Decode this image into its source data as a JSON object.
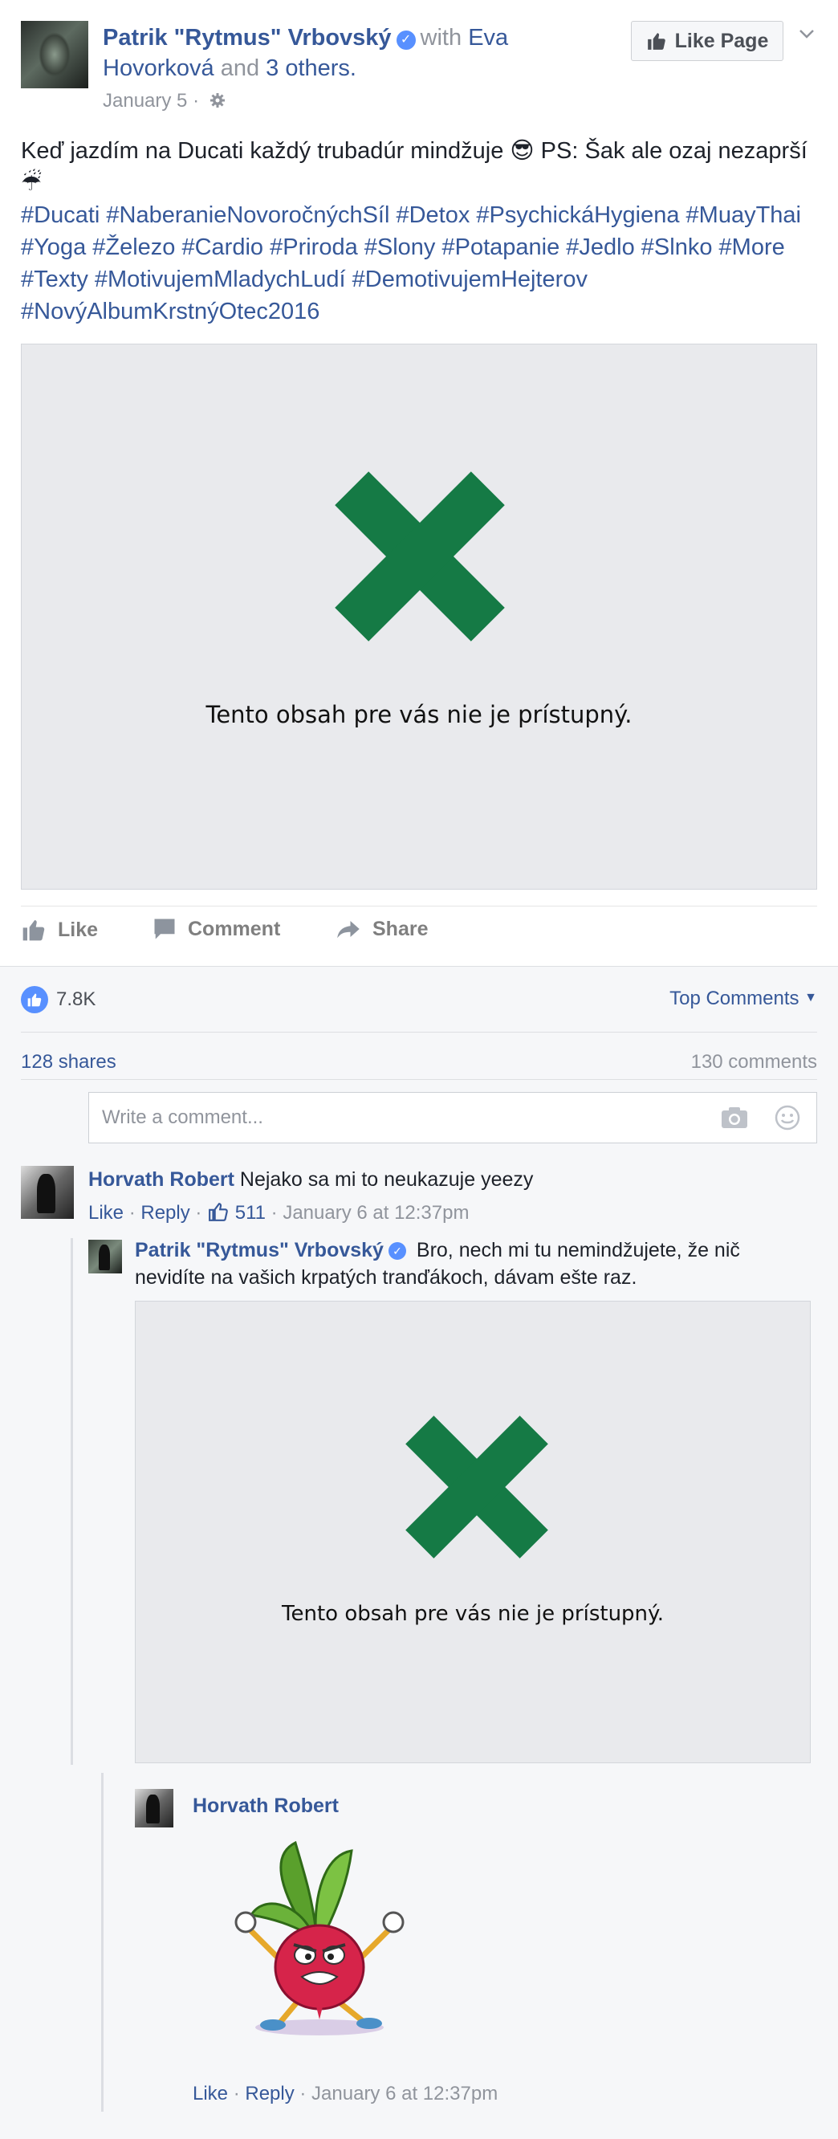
{
  "post": {
    "author": "Patrik \"Rytmus\" Vrbovský",
    "with_word": "with",
    "tagged": "Eva Hovorková",
    "and_word": "and",
    "others": "3 others.",
    "date": "January 5",
    "like_page_label": "Like Page",
    "text": "Keď jazdím na Ducati každý trubadúr mindžuje 😎 PS: Šak ale ozaj nezaprší ☔",
    "hashtags": "#Ducati #NaberanieNovoročnýchSíl #Detox #PsychickáHygiena #MuayThai #Yoga #Železo #Cardio #Priroda #Slony #Potapanie #Jedlo #Slnko #More #Texty #MotivujemMladychLudí #DemotivujemHejterov #NovýAlbumKrstnýOtec2016",
    "media_message": "Tento obsah pre vás nie je prístupný."
  },
  "actions": {
    "like": "Like",
    "comment": "Comment",
    "share": "Share"
  },
  "stats": {
    "likes": "7.8K",
    "top_comments": "Top Comments",
    "shares": "128 shares",
    "comments": "130 comments"
  },
  "comment_box": {
    "placeholder": "Write a comment..."
  },
  "comments": [
    {
      "name": "Horvath Robert",
      "text": "Nejako sa mi to neukazuje yeezy",
      "like": "Like",
      "reply": "Reply",
      "likes": "511",
      "time": "January 6 at 12:37pm"
    }
  ],
  "replies": [
    {
      "name": "Patrik \"Rytmus\" Vrbovský",
      "text": "Bro, nech mi tu nemindžujete, že nič nevidíte na vašich krpatých tranďákoch, dávam ešte raz.",
      "media_message": "Tento obsah pre vás nie je prístupný."
    },
    {
      "name": "Horvath Robert",
      "like": "Like",
      "reply": "Reply",
      "time": "January 6 at 12:37pm"
    }
  ],
  "colors": {
    "link": "#365899",
    "x_mark": "#157a45",
    "accent": "#5890ff"
  },
  "icons": [
    "verified-icon",
    "gear-icon",
    "thumbs-up-icon",
    "chevron-down-icon",
    "comment-icon",
    "share-icon",
    "camera-icon",
    "smiley-icon",
    "x-mark-icon"
  ]
}
